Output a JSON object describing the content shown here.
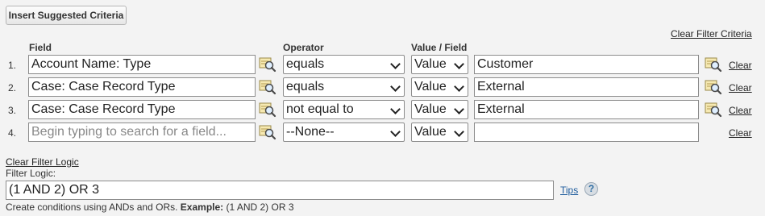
{
  "toolbar": {
    "insert_label": "Insert Suggested Criteria"
  },
  "clear_filter_criteria": "Clear Filter Criteria",
  "headers": {
    "field": "Field",
    "operator": "Operator",
    "value_field": "Value / Field"
  },
  "rows": [
    {
      "num": "1.",
      "field": "Account Name: Type",
      "operator": "equals",
      "value_type": "Value",
      "value": "Customer",
      "has_value_lookup": true,
      "clear": "Clear"
    },
    {
      "num": "2.",
      "field": "Case: Case Record Type",
      "operator": "equals",
      "value_type": "Value",
      "value": "External",
      "has_value_lookup": true,
      "clear": "Clear"
    },
    {
      "num": "3.",
      "field": "Case: Case Record Type",
      "operator": "not equal to",
      "value_type": "Value",
      "value": "External",
      "has_value_lookup": true,
      "clear": "Clear"
    },
    {
      "num": "4.",
      "field_placeholder": "Begin typing to search for a field...",
      "operator": "--None--",
      "value_type": "Value",
      "value": "",
      "has_value_lookup": false,
      "clear": "Clear"
    }
  ],
  "filter_logic": {
    "clear_label": "Clear Filter Logic",
    "label": "Filter Logic:",
    "value": "(1 AND 2) OR 3",
    "tips_label": "Tips",
    "help_glyph": "?",
    "hint_prefix": "Create conditions using ANDs and ORs.",
    "hint_example_label": "Example:",
    "hint_example": "(1 AND 2) OR 3"
  }
}
